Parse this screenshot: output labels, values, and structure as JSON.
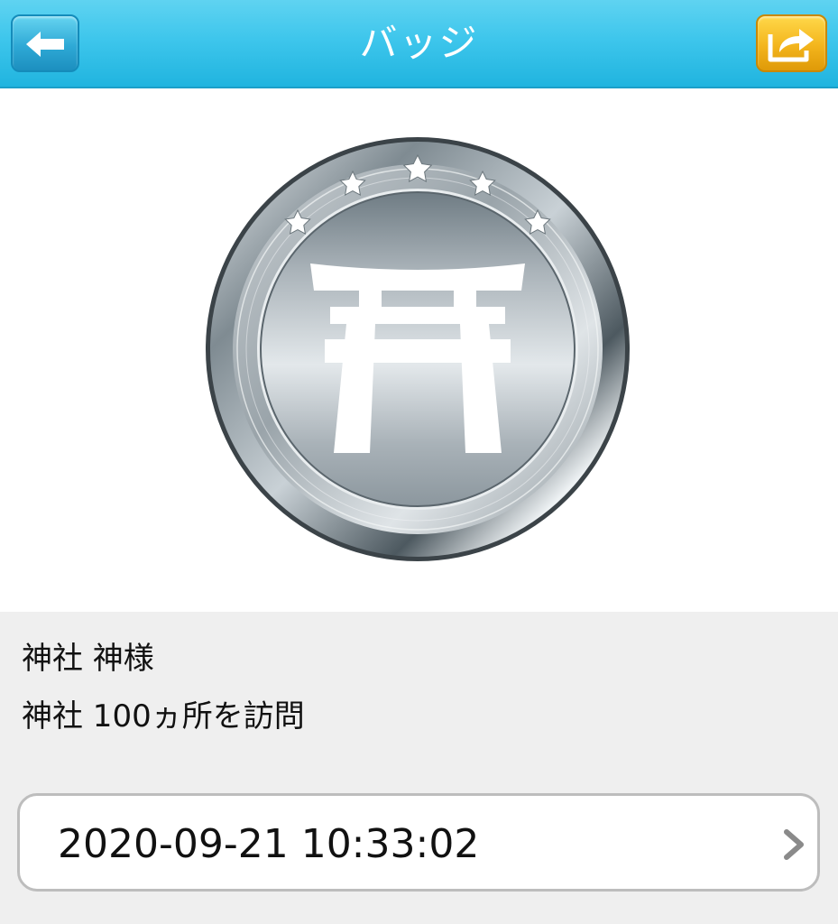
{
  "header": {
    "title": "バッジ",
    "back_icon": "arrow-left-icon",
    "share_icon": "share-icon",
    "back_color": "#2ea9d6",
    "share_color": "#f3b51c",
    "bar_color": "#3ec6ec"
  },
  "badge": {
    "icon": "torii-gate-icon",
    "style": "silver-medal",
    "stars": 5
  },
  "info": {
    "name": "神社 神様",
    "description": "神社 100ヵ所を訪問"
  },
  "date_row": {
    "datetime": "2020-09-21 10:33:02",
    "icon": "chevron-right-icon"
  }
}
